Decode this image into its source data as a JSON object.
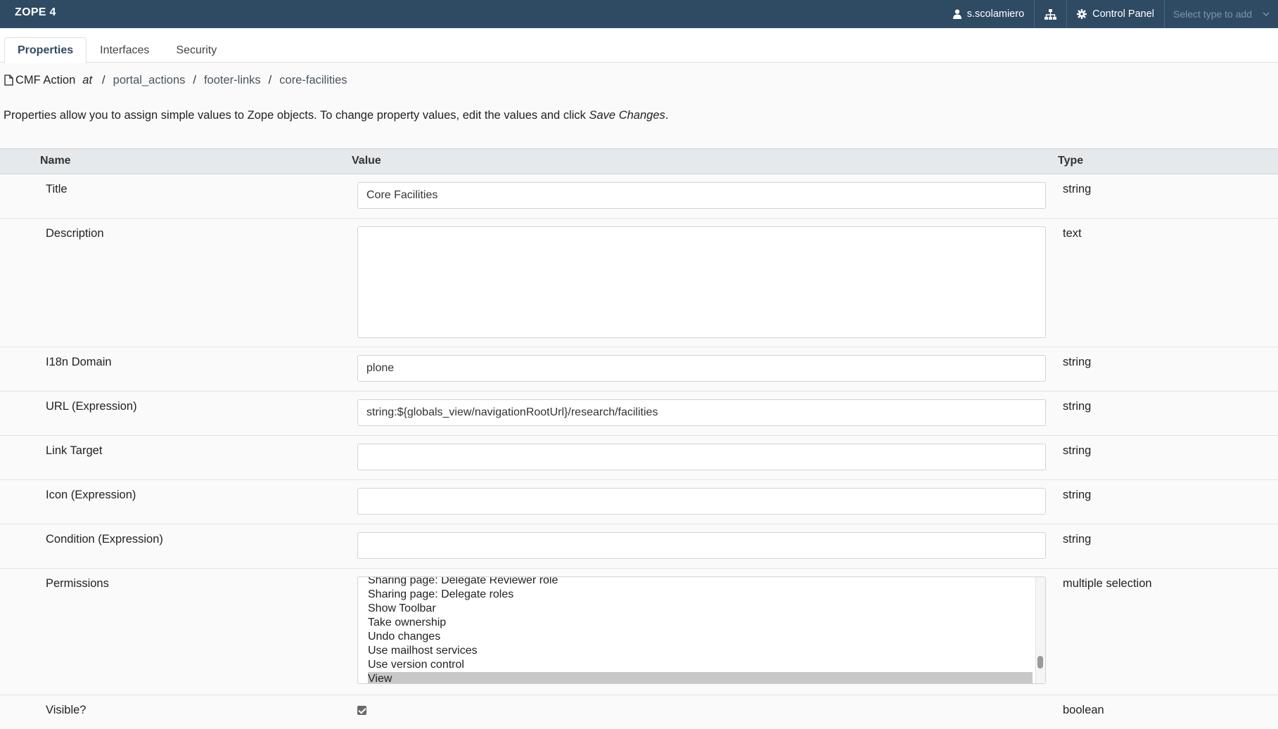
{
  "topbar": {
    "brand": "ZOPE 4",
    "user": "s.scolamiero",
    "control_panel": "Control Panel",
    "select_type_placeholder": "Select type to add"
  },
  "tabs": [
    {
      "label": "Properties",
      "active": true
    },
    {
      "label": "Interfaces",
      "active": false
    },
    {
      "label": "Security",
      "active": false
    }
  ],
  "breadcrumb": {
    "type_label": "CMF Action",
    "at": "at",
    "items": [
      "portal_actions",
      "footer-links",
      "core-facilities"
    ]
  },
  "intro": {
    "text": "Properties allow you to assign simple values to Zope objects. To change property values, edit the values and click ",
    "emphasis": "Save Changes",
    "end": "."
  },
  "table": {
    "headers": {
      "name": "Name",
      "value": "Value",
      "type": "Type"
    },
    "rows": [
      {
        "name": "Title",
        "value": "Core Facilities",
        "type": "string"
      },
      {
        "name": "Description",
        "value": "",
        "type": "text"
      },
      {
        "name": "I18n Domain",
        "value": "plone",
        "type": "string"
      },
      {
        "name": "URL (Expression)",
        "value": "string:${globals_view/navigationRootUrl}/research/facilities",
        "type": "string"
      },
      {
        "name": "Link Target",
        "value": "",
        "type": "string"
      },
      {
        "name": "Icon (Expression)",
        "value": "",
        "type": "string"
      },
      {
        "name": "Condition (Expression)",
        "value": "",
        "type": "string"
      },
      {
        "name": "Permissions",
        "type": "multiple selection",
        "options": [
          "Sharing page: Delegate Reviewer role",
          "Sharing page: Delegate roles",
          "Show Toolbar",
          "Take ownership",
          "Undo changes",
          "Use mailhost services",
          "Use version control",
          "View"
        ],
        "selected": "View"
      },
      {
        "name": "Visible?",
        "checked": true,
        "type": "boolean"
      }
    ]
  },
  "colors": {
    "topbar_bg": "#2f4a63",
    "header_bg": "#e6e9ec",
    "selected_option": "#c8c8c8"
  }
}
